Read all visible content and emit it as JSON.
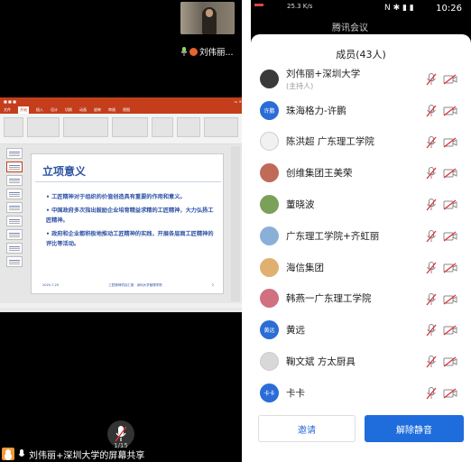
{
  "left": {
    "speaker_name": "刘伟丽...",
    "slide_title": "立项意义",
    "bullets": [
      "• 工匠精神对于组织的价值创造具有重要的作用和意义。",
      "• 中国政府多次指出鼓励企业培育精益求精的工匠精神，大力弘扬工匠精神。",
      "• 政府和企业都积极地推动工匠精神的实践，开展各层面工匠精神的评比等活动。"
    ],
    "slide_footer_left": "2020-7-20",
    "slide_footer_center": "工匠精神项目汇报 · 深圳大学管理学院",
    "slide_footer_right": "2",
    "page_indicator": "1/15",
    "share_label": "刘伟丽+深圳大学的屏幕共享"
  },
  "right": {
    "statusbar_time": "10:26",
    "statusbar_net": "25.3 K/s",
    "behind_title": "腾讯会议",
    "sheet_title": "成员(43人)",
    "members": [
      {
        "name": "刘伟丽+深圳大学",
        "role": "(主持人)",
        "avatar_color": "#3a3a3a",
        "avatar_text": ""
      },
      {
        "name": "珠海格力-许鹏",
        "role": "",
        "avatar_color": "#2b6cd6",
        "avatar_text": "许鹏"
      },
      {
        "name": "陈洪超 广东理工学院",
        "role": "",
        "avatar_color": "#f1f1f1",
        "avatar_text": ""
      },
      {
        "name": "创维集团王美荣",
        "role": "",
        "avatar_color": "#c06a5a",
        "avatar_text": ""
      },
      {
        "name": "董晓波",
        "role": "",
        "avatar_color": "#7aa05a",
        "avatar_text": ""
      },
      {
        "name": "广东理工学院+齐虹丽",
        "role": "",
        "avatar_color": "#8ab0d8",
        "avatar_text": ""
      },
      {
        "name": "海信集团",
        "role": "",
        "avatar_color": "#e0b070",
        "avatar_text": ""
      },
      {
        "name": "韩燕一广东理工学院",
        "role": "",
        "avatar_color": "#d07080",
        "avatar_text": ""
      },
      {
        "name": "黄远",
        "role": "",
        "avatar_color": "#2b6cd6",
        "avatar_text": "黄远"
      },
      {
        "name": "鞠文斌 方太厨具",
        "role": "",
        "avatar_color": "#d8d8d8",
        "avatar_text": ""
      },
      {
        "name": "卡卡",
        "role": "",
        "avatar_color": "#2b6cd6",
        "avatar_text": "卡卡"
      }
    ],
    "invite_label": "邀请",
    "unmute_label": "解除静音"
  },
  "colors": {
    "accent_blue": "#1f6ddc",
    "muted_red": "#e0303a",
    "ppt_red": "#c43e1c",
    "slide_blue": "#2e52a4"
  }
}
